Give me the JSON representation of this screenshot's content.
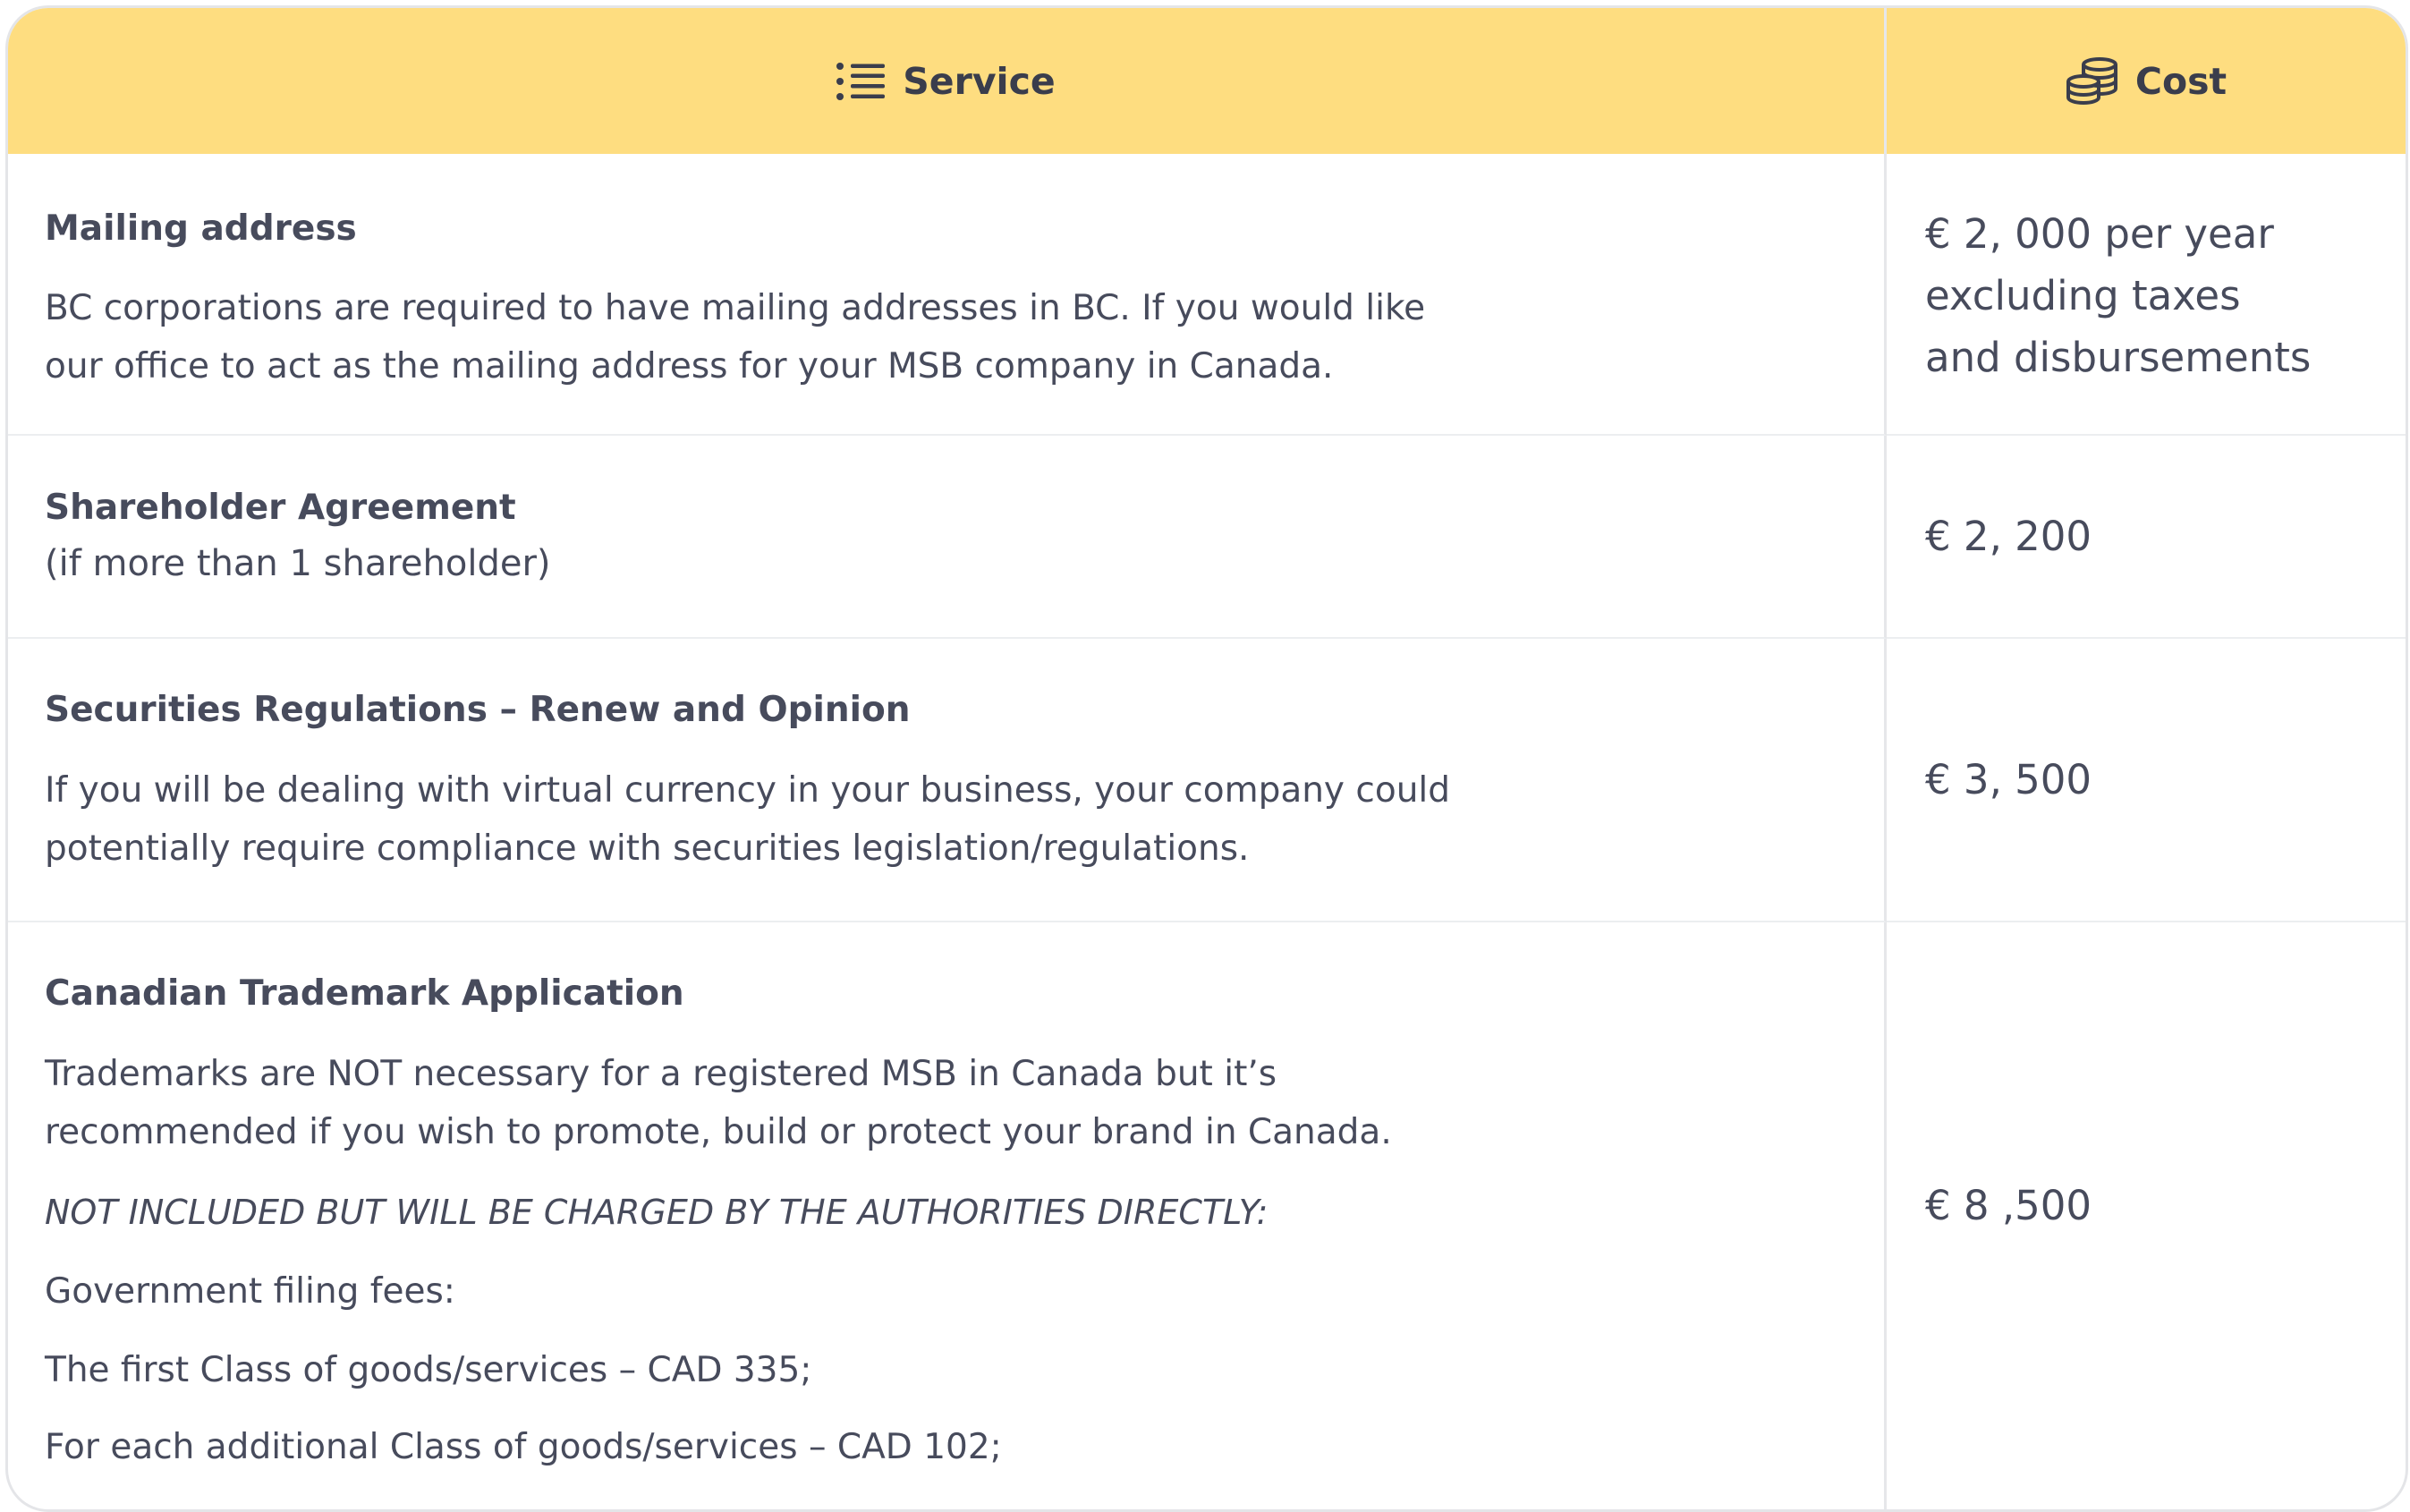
{
  "header": {
    "service_label": "Service",
    "cost_label": "Cost",
    "service_icon": "list-icon",
    "cost_icon": "coins-icon"
  },
  "rows": [
    {
      "title": "Mailing address",
      "lines": [
        "BC corporations are required to have mailing addresses in BC. If you would like",
        "our office to act as the mailing address for your MSB company in Canada."
      ],
      "cost_lines": [
        "€ 2, 000 per year",
        "excluding taxes",
        "and disbursements"
      ]
    },
    {
      "title": "Shareholder Agreement",
      "lines": [
        "(if more than 1 shareholder)"
      ],
      "cost": "€ 2, 200"
    },
    {
      "title": "Securities Regulations – Renew and Opinion",
      "lines": [
        "If you will be dealing with virtual currency in your business, your company could",
        "potentially require compliance with securities legislation/regulations."
      ],
      "cost": "€ 3, 500"
    },
    {
      "title": "Canadian Trademark Application",
      "lines": [
        "Trademarks are NOT necessary for a registered MSB in Canada but it’s",
        "recommended if you wish to promote, build or protect your brand in Canada."
      ],
      "note": "NOT INCLUDED BUT WILL BE CHARGED BY THE AUTHORITIES DIRECTLY:",
      "fees": [
        "Government filing fees:",
        "The first Class of goods/services – CAD 335;",
        "For each additional Class of goods/services – CAD 102;"
      ],
      "cost": "€ 8 ,500"
    }
  ],
  "colors": {
    "header_bg": "#fedd80",
    "text": "#474b5c",
    "border": "#e4e5e8"
  }
}
